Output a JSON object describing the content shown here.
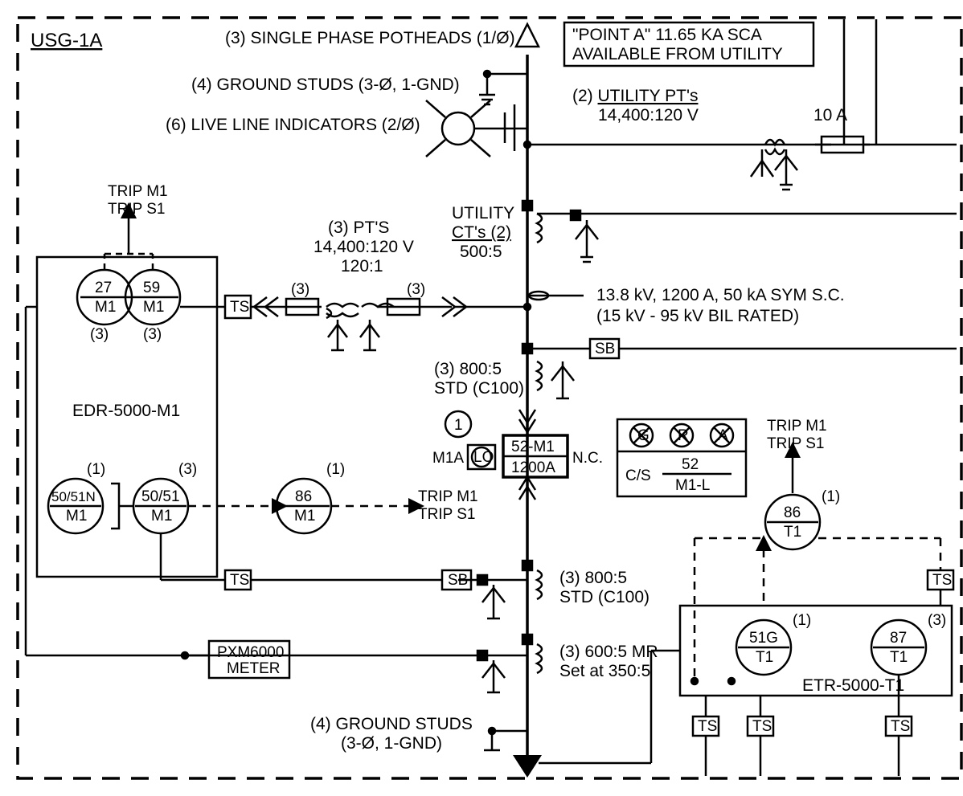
{
  "title": "USG-1A",
  "top": {
    "potheads": "(3) SINGLE PHASE POTHEADS (1/Ø)",
    "gndstuds": "(4) GROUND STUDS (3-Ø, 1-GND)",
    "liveind": "(6) LIVE LINE INDICATORS (2/Ø)",
    "pointA1": "\"POINT A\" 11.65 KA SCA",
    "pointA2": "AVAILABLE FROM UTILITY",
    "utilpt_h": "(2)",
    "utilpt_u": "UTILITY PT's",
    "utilpt_r": "14,400:120 V",
    "fuse": "10 A"
  },
  "leftTop": {
    "trip1": "TRIP M1",
    "trip2": "TRIP S1",
    "r27t": "27",
    "r27b": "M1",
    "r59t": "59",
    "r59b": "M1",
    "c3a": "(3)",
    "c3b": "(3)",
    "device": "EDR-5000-M1",
    "ts": "TS"
  },
  "pts": {
    "h": "(3) PT'S",
    "r1": "14,400:120 V",
    "r2": "120:1",
    "q1": "(3)",
    "q2": "(3)"
  },
  "bus": {
    "utilct1": "UTILITY",
    "utilct2": "CT's (2)",
    "utilct3": "500:5",
    "rating1": "13.8 kV, 1200 A, 50 kA SYM S.C.",
    "rating2": "(15 kV - 95 kV BIL RATED)",
    "sb": "SB",
    "ct8001": "(3) 800:5",
    "ct8002": "STD (C100)",
    "ct800b1": "(3) 800:5",
    "ct800b2": "STD (C100)",
    "ct6001": "(3) 600:5 MR",
    "ct6002": "Set at 350:5",
    "bgnd1": "(4) GROUND STUDS",
    "bgnd2": "(3-Ø, 1-GND)"
  },
  "breaker": {
    "one": "1",
    "m1a": "M1A",
    "lo": "LO",
    "top": "52-M1",
    "bot": "1200A",
    "nc": "N.C."
  },
  "leftBot": {
    "q1": "(1)",
    "q3": "(3)",
    "q1b": "(1)",
    "r5051Nt": "50/51N",
    "r5051Nb": "M1",
    "r5051t": "50/51",
    "r5051b": "M1",
    "r86t": "86",
    "r86b": "M1",
    "trip1": "TRIP M1",
    "trip2": "TRIP S1",
    "ts": "TS",
    "sb": "SB",
    "pxm1": "PXM6000",
    "pxm2": "METER"
  },
  "right": {
    "G": "G",
    "R": "R",
    "A": "A",
    "cs": "C/S",
    "f52": "52",
    "m1l": "M1-L",
    "trip1": "TRIP M1",
    "trip2": "TRIP S1",
    "q1a": "(1)",
    "r86t": "86",
    "r86b": "T1",
    "q1b": "(1)",
    "q3": "(3)",
    "r51Gt": "51G",
    "r51Gb": "T1",
    "r87t": "87",
    "r87b": "T1",
    "device": "ETR-5000-T1",
    "ts": "TS"
  }
}
